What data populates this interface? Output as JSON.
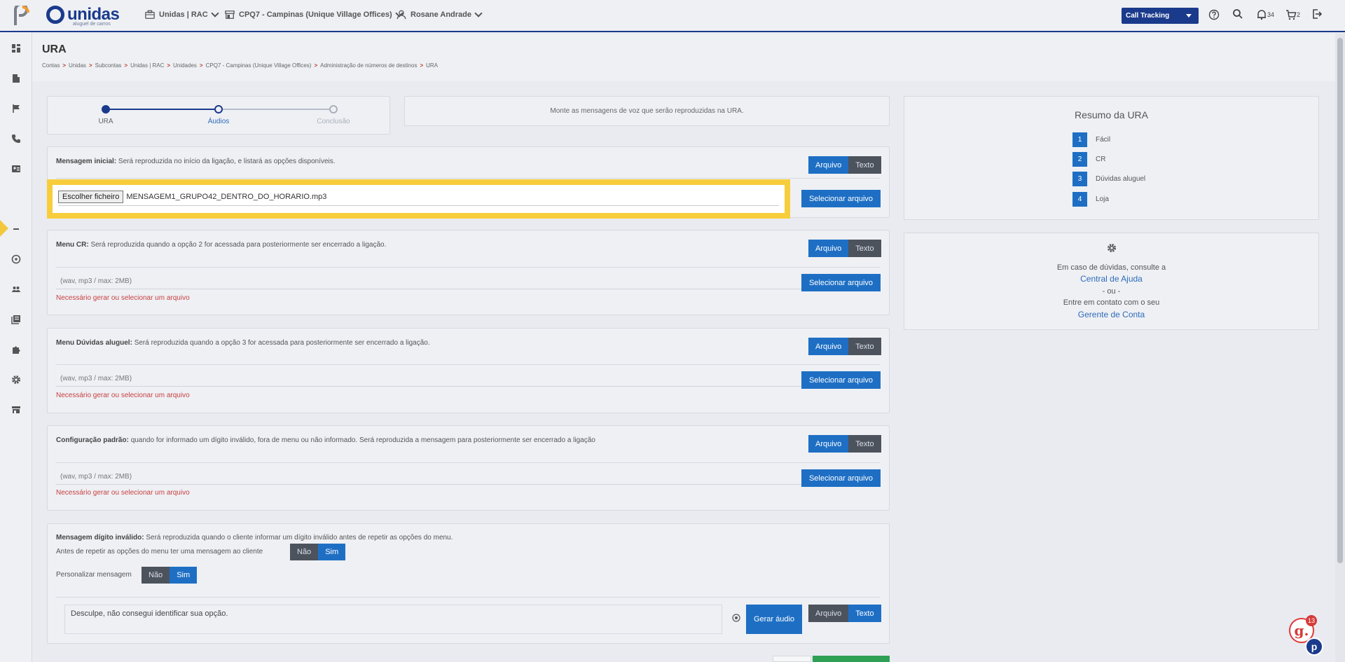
{
  "header": {
    "brand": "unidas",
    "brand_sub": "aluguel de carros",
    "nav": {
      "unit": "Unidas | RAC",
      "location": "CPQ7 - Campinas (Unique Village Offices)",
      "user": "Rosane Andrade"
    },
    "call_tracking": "Call Tracking",
    "notifications_count": "34",
    "cart_count": "2"
  },
  "page": {
    "title": "URA",
    "breadcrumbs": [
      "Contas",
      "Unidas",
      "Subcontas",
      "Unidas | RAC",
      "Unidades",
      "CPQ7 - Campinas (Unique Village Offices)",
      "Administração de números de destinos",
      "URA"
    ]
  },
  "stepper": {
    "steps": [
      "URA",
      "Áudios",
      "Conclusão"
    ]
  },
  "info": "Monte as mensagens de voz que serão reproduzidas na URA.",
  "toggle_labels": {
    "file": "Arquivo",
    "text": "Texto",
    "no": "Não",
    "yes": "Sim"
  },
  "sections": {
    "initial": {
      "title": "Mensagem inicial:",
      "desc": "Será reproduzida no início da ligação, e listará as opções disponíveis.",
      "choose_file": "Escolher ficheiro",
      "file_name": "MENSAGEM1_GRUPO42_DENTRO_DO_HORARIO.mp3",
      "select_btn": "Selecionar arquivo"
    },
    "menu_cr": {
      "title": "Menu CR:",
      "desc": "Será reproduzida quando a opção 2 for acessada para posteriormente ser encerrado a ligação.",
      "placeholder": "(wav, mp3 / max: 2MB)",
      "select_btn": "Selecionar arquivo",
      "error": "Necessário gerar ou selecionar um arquivo"
    },
    "menu_duvidas": {
      "title": "Menu Dúvidas aluguel:",
      "desc": "Será reproduzida quando a opção 3 for acessada para posteriormente ser encerrado a ligação.",
      "placeholder": "(wav, mp3 / max: 2MB)",
      "select_btn": "Selecionar arquivo",
      "error": "Necessário gerar ou selecionar um arquivo"
    },
    "config": {
      "title": "Configuração padrão:",
      "desc": "quando for informado um dígito inválido, fora de menu ou não informado. Será reproduzida a mensagem para posteriormente ser encerrado a ligação",
      "placeholder": "(wav, mp3 / max: 2MB)",
      "select_btn": "Selecionar arquivo",
      "error": "Necessário gerar ou selecionar um arquivo"
    },
    "invalid": {
      "title": "Mensagem dígito inválido:",
      "desc": "Será reproduzida quando o cliente informar um dígito inválido antes de repetir as opções do menu.",
      "question": "Antes de repetir as opções do menu ter uma mensagem ao cliente",
      "personalize": "Personalizar mensagem",
      "message": "Desculpe, não consegui identificar sua opção.",
      "generate_btn": "Gerar áudio"
    }
  },
  "summary": {
    "title": "Resumo da URA",
    "items": [
      {
        "num": "1",
        "label": "Fácil"
      },
      {
        "num": "2",
        "label": "CR"
      },
      {
        "num": "3",
        "label": "Dúvidas aluguel"
      },
      {
        "num": "4",
        "label": "Loja"
      }
    ]
  },
  "help": {
    "line1": "Em caso de dúvidas, consulte a",
    "link1": "Central de Ajuda",
    "or": "- ou -",
    "line2": "Entre em contato com o seu",
    "link2": "Gerente de Conta"
  },
  "float": {
    "badge_letter": "g.",
    "badge_count": "13",
    "p_letter": "p"
  }
}
